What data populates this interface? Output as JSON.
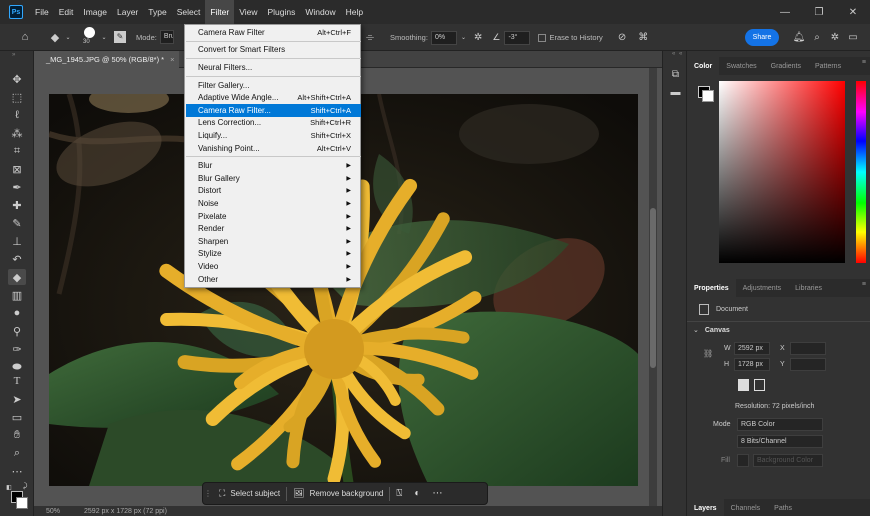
{
  "menubar": {
    "logo": "Ps",
    "items": [
      "File",
      "Edit",
      "Image",
      "Layer",
      "Type",
      "Select",
      "Filter",
      "View",
      "Plugins",
      "Window",
      "Help"
    ],
    "active_index": 6
  },
  "options": {
    "brush_size": "30",
    "mode_label": "Mode:",
    "mode_value": "Bru",
    "smoothing_label": "Smoothing:",
    "smoothing_value": "0%",
    "angle_value": "-3°",
    "erase_to_history": "Erase to History",
    "share_label": "Share"
  },
  "document": {
    "tab_title": "_MG_1945.JPG @ 50% (RGB/8*) *",
    "tab_close": "×",
    "zoom": "50%",
    "dimensions": "2592 px x 1728 px (72 ppi)"
  },
  "filter_menu": {
    "items": [
      {
        "label": "Camera Raw Filter",
        "shortcut": "Alt+Ctrl+F"
      },
      {
        "separator": true
      },
      {
        "label": "Convert for Smart Filters",
        "shortcut": ""
      },
      {
        "separator": true
      },
      {
        "label": "Neural Filters...",
        "shortcut": ""
      },
      {
        "separator": true
      },
      {
        "label": "Filter Gallery...",
        "shortcut": ""
      },
      {
        "label": "Adaptive Wide Angle...",
        "shortcut": "Alt+Shift+Ctrl+A"
      },
      {
        "label": "Camera Raw Filter...",
        "shortcut": "Shift+Ctrl+A",
        "highlighted": true
      },
      {
        "label": "Lens Correction...",
        "shortcut": "Shift+Ctrl+R"
      },
      {
        "label": "Liquify...",
        "shortcut": "Shift+Ctrl+X"
      },
      {
        "label": "Vanishing Point...",
        "shortcut": "Alt+Ctrl+V"
      },
      {
        "separator": true
      },
      {
        "label": "Blur",
        "submenu": true
      },
      {
        "label": "Blur Gallery",
        "submenu": true
      },
      {
        "label": "Distort",
        "submenu": true
      },
      {
        "label": "Noise",
        "submenu": true
      },
      {
        "label": "Pixelate",
        "submenu": true
      },
      {
        "label": "Render",
        "submenu": true
      },
      {
        "label": "Sharpen",
        "submenu": true
      },
      {
        "label": "Stylize",
        "submenu": true
      },
      {
        "label": "Video",
        "submenu": true
      },
      {
        "label": "Other",
        "submenu": true
      }
    ]
  },
  "taskbar": {
    "select_subject": "Select subject",
    "remove_background": "Remove background"
  },
  "color_panel": {
    "tabs": [
      "Color",
      "Swatches",
      "Gradients",
      "Patterns"
    ],
    "foreground": "#000000",
    "background": "#ffffff",
    "hue": "#ff0000"
  },
  "properties_panel": {
    "tabs": [
      "Properties",
      "Adjustments",
      "Libraries"
    ],
    "document_label": "Document",
    "section": "Canvas",
    "w_label": "W",
    "w_value": "2592 px",
    "x_label": "X",
    "h_label": "H",
    "h_value": "1728 px",
    "y_label": "Y",
    "resolution": "Resolution: 72 pixels/inch",
    "mode_label": "Mode",
    "mode_value": "RGB Color",
    "bits_value": "8 Bits/Channel",
    "fill_label": "Fill",
    "fill_value": "Background Color"
  },
  "layers_panel": {
    "tabs": [
      "Layers",
      "Channels",
      "Paths"
    ]
  }
}
